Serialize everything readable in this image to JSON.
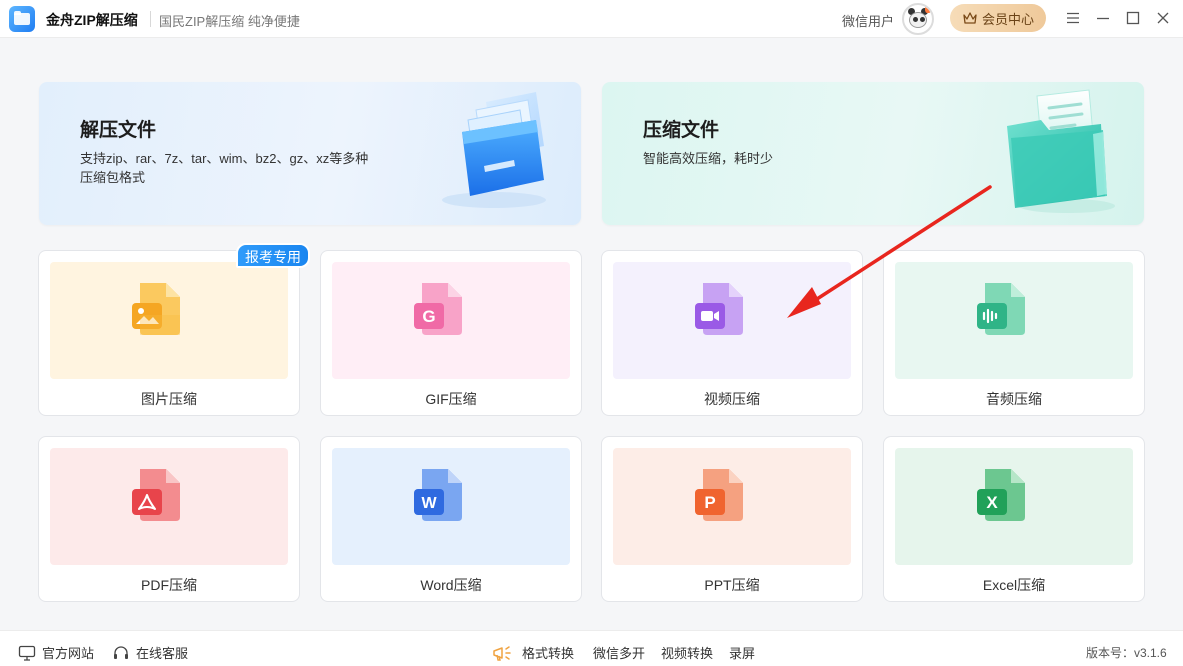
{
  "titlebar": {
    "app_name": "金舟ZIP解压缩",
    "slogan": "国民ZIP解压缩  纯净便捷",
    "user_name": "微信用户",
    "vip_label": "会员中心"
  },
  "hero": {
    "extract": {
      "title": "解压文件",
      "desc": "支持zip、rar、7z、tar、wim、bz2、gz、xz等多种压缩包格式"
    },
    "compress": {
      "title": "压缩文件",
      "desc": "智能高效压缩，耗时少"
    }
  },
  "tools": [
    {
      "label": "图片压缩",
      "bg": "#fff4e0",
      "icon": "image-file-icon",
      "color": "#f5a623"
    },
    {
      "label": "GIF压缩",
      "bg": "#ffeef6",
      "icon": "gif-file-icon",
      "color": "#f06aa6",
      "glyph": "G"
    },
    {
      "label": "视频压缩",
      "bg": "#f4f1fd",
      "icon": "video-file-icon",
      "color": "#9a5ae6"
    },
    {
      "label": "音频压缩",
      "bg": "#e8f7f1",
      "icon": "audio-file-icon",
      "color": "#2fb487"
    },
    {
      "label": "PDF压缩",
      "bg": "#fdeaea",
      "icon": "pdf-file-icon",
      "color": "#e8444b"
    },
    {
      "label": "Word压缩",
      "bg": "#e5f0fd",
      "icon": "word-file-icon",
      "color": "#2f6ae0",
      "glyph": "W"
    },
    {
      "label": "PPT压缩",
      "bg": "#fdede7",
      "icon": "ppt-file-icon",
      "color": "#f0642f",
      "glyph": "P"
    },
    {
      "label": "Excel压缩",
      "bg": "#e6f5ec",
      "icon": "excel-file-icon",
      "color": "#21a159",
      "glyph": "X"
    }
  ],
  "badge": "报考专用",
  "footer": {
    "website": "官方网站",
    "service": "在线客服",
    "format_convert": "格式转换",
    "wechat_multi": "微信多开",
    "video_convert": "视频转换",
    "screen_record": "录屏",
    "version": "版本号：v3.1.6"
  }
}
